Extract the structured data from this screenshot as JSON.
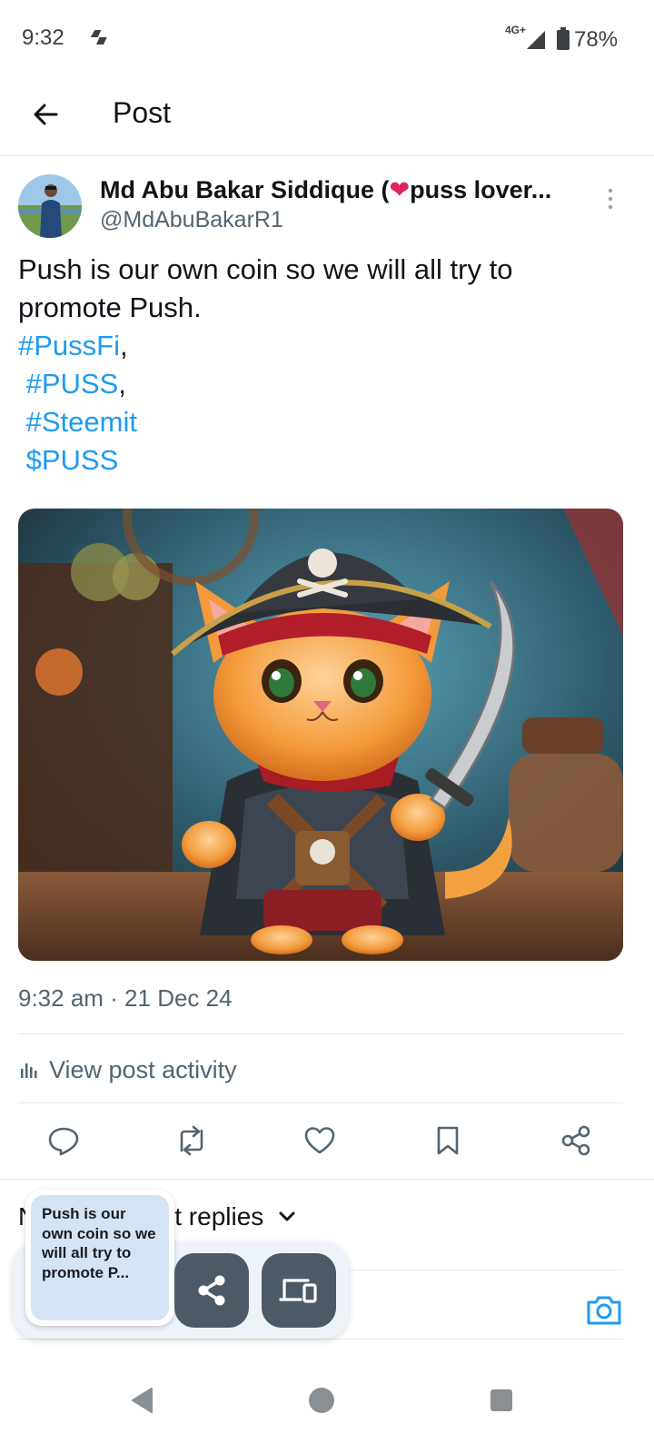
{
  "status_bar": {
    "time": "9:32",
    "network": "4G+",
    "battery": "78%",
    "icons": [
      "app-notification-icon",
      "signal-icon",
      "battery-icon"
    ]
  },
  "header": {
    "title": "Post",
    "back_icon": "arrow-left-icon"
  },
  "post": {
    "author": {
      "name_before": "Md Abu Bakar Siddique (",
      "name_heart": "❤",
      "name_after": "puss lover...",
      "handle": "@MdAbuBakarR1"
    },
    "text_lines": [
      "Push is our own coin so we will all try to",
      "promote Push."
    ],
    "hashtags": [
      {
        "tag": "#PussFi",
        "suffix": ","
      },
      {
        "tag": " #PUSS",
        "suffix": ","
      },
      {
        "tag": " #Steemit",
        "suffix": ""
      },
      {
        "tag": " $PUSS",
        "suffix": ""
      }
    ],
    "image_description_icon": "pirate-cat-image",
    "timestamp": "9:32 am · 21 Dec 24",
    "activity_label": "View post activity"
  },
  "actions": {
    "icons": [
      "reply-icon",
      "repost-icon",
      "like-icon",
      "bookmark-icon",
      "share-icon"
    ]
  },
  "replies": {
    "sort_label_visible": "t replies",
    "sort_label_hidden_prefix": "N"
  },
  "share_overlay": {
    "card_text": "Push is our own coin so we will all try to promote P..."
  },
  "colors": {
    "accent": "#1d9bf0",
    "text_primary": "#0f1419",
    "text_secondary": "#536471",
    "divider": "#e6e9eb",
    "share_button_bg": "#4d5a66",
    "heart": "#e0245e"
  }
}
